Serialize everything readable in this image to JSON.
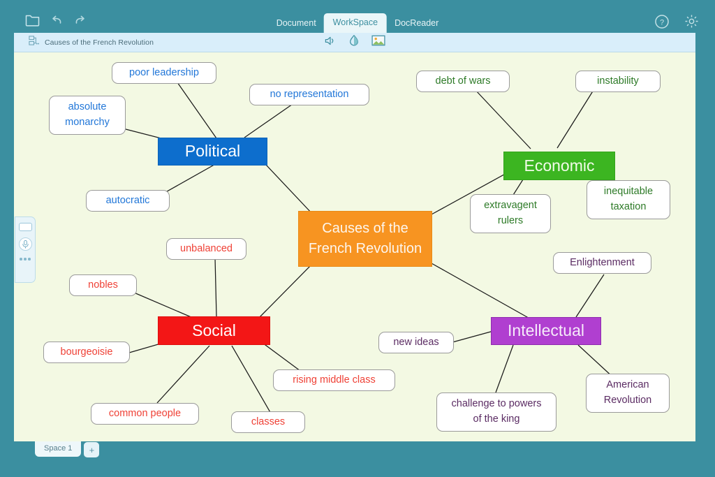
{
  "window": {
    "frame_color": "#3b8fa0",
    "canvas_bg": "#f3f9e3"
  },
  "topbar": {
    "folder_icon": "folder-icon",
    "undo_icon": "undo-icon",
    "redo_icon": "redo-icon",
    "help_icon": "help-icon",
    "settings_icon": "gear-icon",
    "tabs": [
      {
        "label": "Document",
        "active": false
      },
      {
        "label": "WorkSpace",
        "active": true
      },
      {
        "label": "DocReader",
        "active": false
      }
    ]
  },
  "docbar": {
    "doc_icon": "mindmap-document-icon",
    "title": "Causes of the French Revolution",
    "tools": [
      {
        "name": "speaker-icon"
      },
      {
        "name": "highlighter-icon"
      },
      {
        "name": "image-icon"
      }
    ]
  },
  "toolpanel": {
    "shape_tool": "rectangle-shape-tool",
    "mic_tool": "microphone-icon",
    "more_tool": "more-options-icon"
  },
  "spacebar": {
    "tabs": [
      {
        "label": "Space 1"
      }
    ],
    "add_label": "+"
  },
  "mindmap": {
    "center": {
      "line1": "Causes of the",
      "line2": "French Revolution",
      "fill": "#f79421",
      "text_color": "#fdf6ee"
    },
    "branches": [
      {
        "id": "political",
        "label": "Political",
        "fill": "#0d6ecd",
        "text_color": "#ffffff",
        "child_text_color": "#2277d8",
        "children": [
          {
            "lines": [
              "poor leadership"
            ]
          },
          {
            "lines": [
              "no representation"
            ]
          },
          {
            "lines": [
              "absolute",
              "monarchy"
            ]
          },
          {
            "lines": [
              "autocratic"
            ]
          }
        ]
      },
      {
        "id": "economic",
        "label": "Economic",
        "fill": "#3cb521",
        "text_color": "#f2fbe9",
        "child_text_color": "#2d7a27",
        "children": [
          {
            "lines": [
              "debt of wars"
            ]
          },
          {
            "lines": [
              "instability"
            ]
          },
          {
            "lines": [
              "extravagent",
              "rulers"
            ]
          },
          {
            "lines": [
              "inequitable",
              "taxation"
            ]
          }
        ]
      },
      {
        "id": "social",
        "label": "Social",
        "fill": "#f31616",
        "text_color": "#ffffff",
        "child_text_color": "#ef4136",
        "children": [
          {
            "lines": [
              "unbalanced"
            ]
          },
          {
            "lines": [
              "nobles"
            ]
          },
          {
            "lines": [
              "bourgeoisie"
            ]
          },
          {
            "lines": [
              "common people"
            ]
          },
          {
            "lines": [
              "classes"
            ]
          },
          {
            "lines": [
              "rising middle class"
            ]
          }
        ]
      },
      {
        "id": "intellectual",
        "label": "Intellectual",
        "fill": "#b03fd0",
        "text_color": "#f6ebfa",
        "child_text_color": "#5b2c63",
        "children": [
          {
            "lines": [
              "Enlightenment"
            ]
          },
          {
            "lines": [
              "new ideas"
            ]
          },
          {
            "lines": [
              "challenge to powers",
              "of the king"
            ]
          },
          {
            "lines": [
              "American",
              "Revolution"
            ]
          }
        ]
      }
    ]
  }
}
